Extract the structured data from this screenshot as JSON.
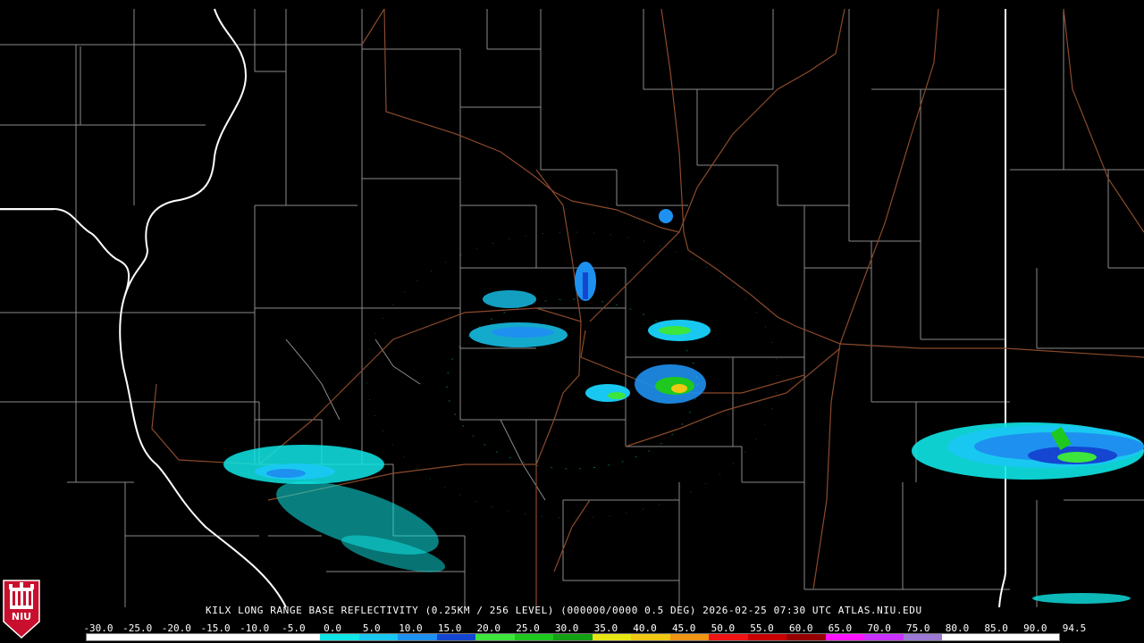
{
  "title": "KILX LONG RANGE BASE REFLECTIVITY (0.25KM / 256 LEVEL) (000000/0000 0.5 DEG) 2026-02-25 07:30 UTC  ATLAS.NIU.EDU",
  "logo": {
    "text": "NIU",
    "icon": "university-tower-logo"
  },
  "scale": {
    "labels": [
      "-30.0",
      "-25.0",
      "-20.0",
      "-15.0",
      "-10.0",
      "-5.0",
      "0.0",
      "5.0",
      "10.0",
      "15.0",
      "20.0",
      "25.0",
      "30.0",
      "35.0",
      "40.0",
      "45.0",
      "50.0",
      "55.0",
      "60.0",
      "65.0",
      "70.0",
      "75.0",
      "80.0",
      "85.0",
      "90.0",
      "94.5"
    ],
    "colors": [
      "#ffffff",
      "#ffffff",
      "#ffffff",
      "#ffffff",
      "#ffffff",
      "#ffffff",
      "#10e6e6",
      "#18c8f0",
      "#1e90f0",
      "#1446d2",
      "#3ce63c",
      "#1ec81e",
      "#14a014",
      "#e6e614",
      "#f0c814",
      "#f09614",
      "#f01414",
      "#c80000",
      "#960000",
      "#ff14ff",
      "#c832ff",
      "#9b78d2",
      "#ffffff",
      "#ffffff",
      "#ffffff"
    ]
  },
  "colors": {
    "background": "#000000",
    "county_lines": "#8a8a8a",
    "state_lines": "#ffffff",
    "highways": "#8b4a2b",
    "logo_red": "#c8102e"
  }
}
